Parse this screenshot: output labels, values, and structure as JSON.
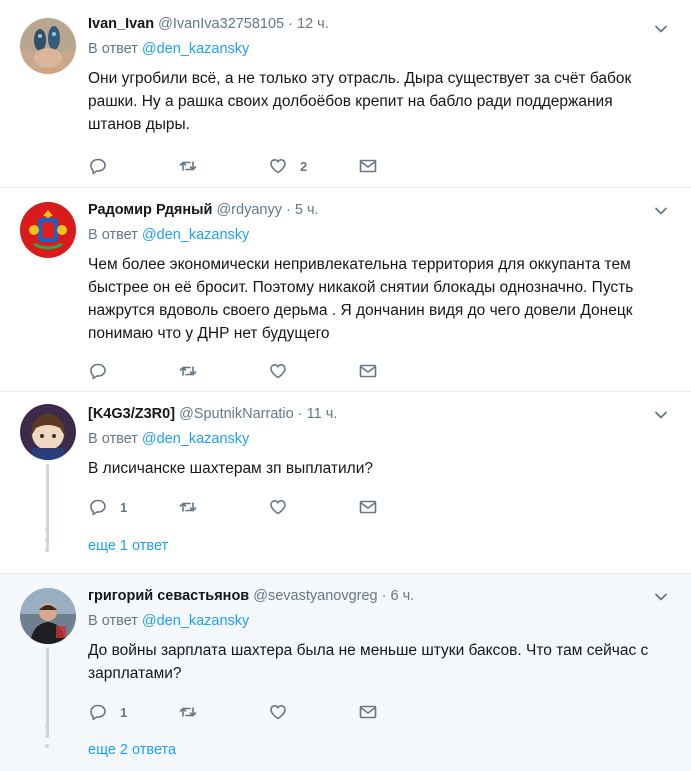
{
  "tweets": [
    {
      "name": "Ivan_Ivan",
      "handle": "@IvanIva32758105",
      "time": "12 ч.",
      "reply_label": "В ответ",
      "reply_to": "@den_kazansky",
      "text": "Они угробили всё, а не только эту отрасль. Дыра существует за счёт бабок рашки. Ну а рашка своих долбоёбов крепит на бабло ради поддержания штанов дыры.",
      "replies": "",
      "retweets": "",
      "likes": "2"
    },
    {
      "name": "Радомир Рдяный",
      "handle": "@rdyanyy",
      "time": "5 ч.",
      "reply_label": "В ответ",
      "reply_to": "@den_kazansky",
      "text": "Чем более экономически непривлекательна территория для оккупанта тем быстрее он её бросит. Поэтому никакой снятии блокады однозначно. Пусть нажрутся вдоволь своего дерьма . Я дончанин видя до чего довели Донецк понимаю что у ДНР нет будущего",
      "replies": "",
      "retweets": "",
      "likes": ""
    },
    {
      "name": "[K4G3/Z3R0]",
      "handle": "@SputnikNarratio",
      "time": "11 ч.",
      "reply_label": "В ответ",
      "reply_to": "@den_kazansky",
      "text": "В лисичанске шахтерам зп выплатили?",
      "replies": "1",
      "retweets": "",
      "likes": "",
      "more": "еще 1 ответ"
    },
    {
      "name": "григорий севастьянов",
      "handle": "@sevastyanovgreg",
      "time": "6 ч.",
      "reply_label": "В ответ",
      "reply_to": "@den_kazansky",
      "text": "До войны зарплата шахтера была не меньше штуки баксов. Что там сейчас с зарплатами?",
      "replies": "1",
      "retweets": "",
      "likes": "",
      "more": "еще 2 ответа"
    }
  ],
  "colors": {
    "accent": "#1da1f2",
    "muted": "#657786",
    "text": "#14171a",
    "border": "#e6ecf0",
    "highlight_bg": "#f5f8fa",
    "thread": "#ccd6dd"
  }
}
